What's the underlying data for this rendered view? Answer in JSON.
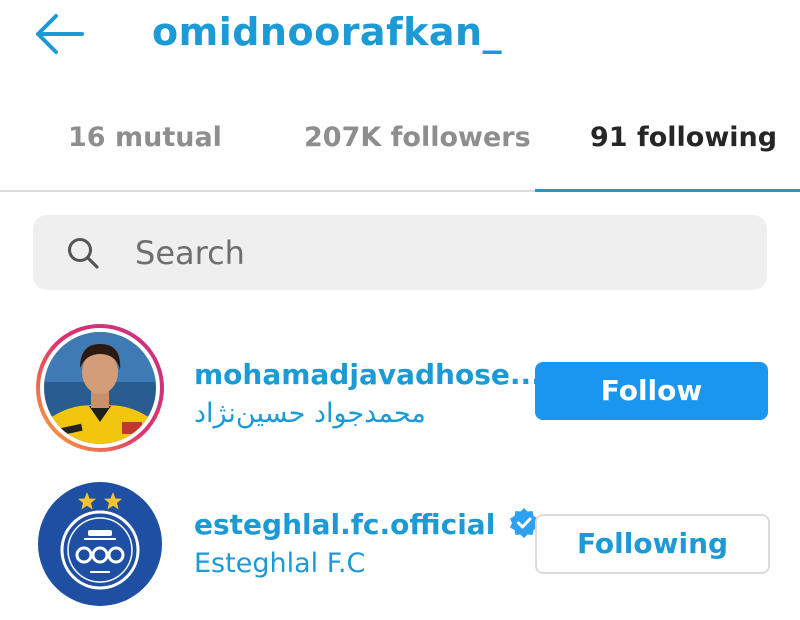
{
  "header": {
    "title": "omidnoorafkan_",
    "back_icon": "arrow-left-icon"
  },
  "tabs": [
    {
      "label": "16 mutual",
      "active": false
    },
    {
      "label": "207K followers",
      "active": false
    },
    {
      "label": "91 following",
      "active": true
    }
  ],
  "search": {
    "placeholder": "Search",
    "value": ""
  },
  "accounts": [
    {
      "username": "mohamadjavadhose...",
      "full_name": "محمدجواد حسین‌نژاد",
      "button": "Follow",
      "verified": false,
      "story_ring": true
    },
    {
      "username": "esteghlal.fc.official",
      "full_name": "Esteghlal F.C",
      "button": "Following",
      "verified": true,
      "story_ring": false
    }
  ],
  "colors": {
    "accent": "#1b9ad6",
    "follow_button": "#1a96f0",
    "search_bg": "#efefef"
  }
}
